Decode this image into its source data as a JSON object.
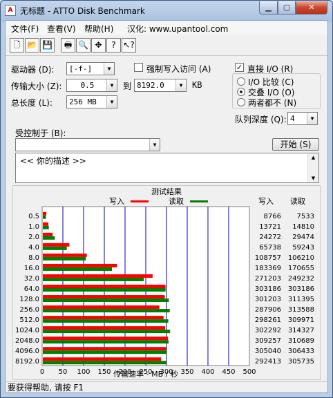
{
  "window": {
    "title": "无标题 - ATTO Disk Benchmark"
  },
  "menu": {
    "file": "文件(F)",
    "view": "查看(V)",
    "help": "帮助(H)",
    "localize": "汉化: www.upantool.com"
  },
  "toolbar": {
    "new": "D",
    "open": "O",
    "save": "S",
    "print": "P",
    "preview": "Q",
    "move": "+",
    "help": "?",
    "whatsthis": "?"
  },
  "form": {
    "drive_label": "驱动器 (D):",
    "drive_value": "[-f-]",
    "transfer_label": "传输大小 (Z):",
    "transfer_from": "0.5",
    "transfer_to_label": "到",
    "transfer_to": "8192.0",
    "kb": "KB",
    "total_label": "总长度 (L):",
    "total_value": "256 MB",
    "force_write_label": "强制写入访问 (A)",
    "force_write_checked": "",
    "direct_io_label": "直接 I/O (R)",
    "direct_io_checked": "✓",
    "io_compare": "I/O 比较 (C)",
    "overlap_io": "交叠 I/O (O)",
    "neither": "两者都不 (N)",
    "queue_label": "队列深度 (Q):",
    "queue_value": "4",
    "controlled_label": "受控制于 (B):",
    "controlled_value": "",
    "start_button": "开始 (S)",
    "description": "<<   你的描述   >>"
  },
  "chart_data": {
    "type": "bar",
    "title": "测试结果",
    "legend_write": "写入",
    "legend_read": "读取",
    "col_write": "写入",
    "col_read": "读取",
    "xlabel": "传输速率 - MB / 秒",
    "categories": [
      "0.5",
      "1.0",
      "2.0",
      "4.0",
      "8.0",
      "16.0",
      "32.0",
      "64.0",
      "128.0",
      "256.0",
      "512.0",
      "1024.0",
      "2048.0",
      "4096.0",
      "8192.0"
    ],
    "xlim": [
      0,
      500
    ],
    "xticks": [
      "0",
      "50",
      "100",
      "150",
      "200",
      "250",
      "300",
      "350",
      "400",
      "450",
      "500"
    ],
    "series": [
      {
        "name": "写入",
        "color": "#ff0000",
        "values": [
          8766,
          13721,
          24272,
          65738,
          108757,
          183369,
          271203,
          303186,
          301203,
          287906,
          298261,
          302292,
          309257,
          305040,
          292413
        ]
      },
      {
        "name": "读取",
        "color": "#008000",
        "values": [
          7533,
          14810,
          29474,
          59243,
          106210,
          170655,
          249232,
          303186,
          311395,
          313588,
          309971,
          314327,
          310689,
          306433,
          305735
        ]
      }
    ]
  },
  "status": {
    "text": "要获得帮助, 请按 F1"
  },
  "colors": {
    "chart_bg": "#ffffff",
    "grid": "#0000c0"
  }
}
